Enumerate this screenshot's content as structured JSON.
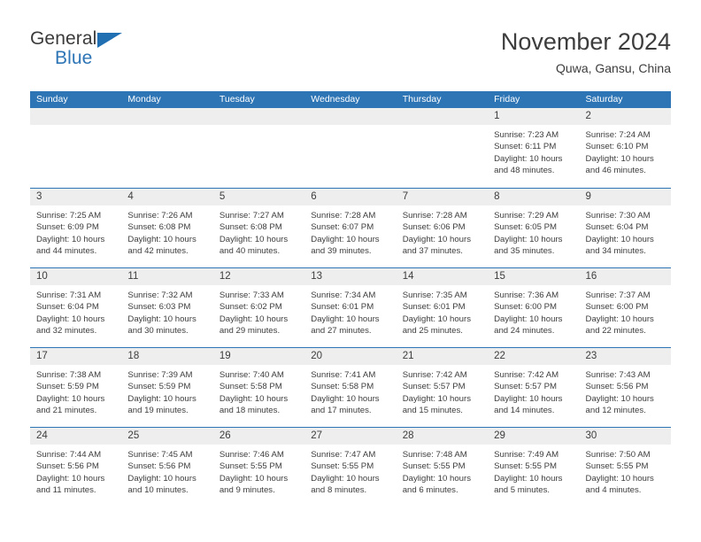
{
  "brand": {
    "word_general": "General",
    "word_blue": "Blue",
    "triangle_color": "#1f6fb2",
    "blue_color": "#2e75b6"
  },
  "header": {
    "title": "November 2024",
    "location": "Quwa, Gansu, China"
  },
  "calendar": {
    "header_color": "#2e75b6",
    "daynum_strip_color": "#eeeeee",
    "weekdays": [
      "Sunday",
      "Monday",
      "Tuesday",
      "Wednesday",
      "Thursday",
      "Friday",
      "Saturday"
    ],
    "weeks": [
      [
        {
          "day": "",
          "sunrise": "",
          "sunset": "",
          "daylight_line1": "",
          "daylight_line2": ""
        },
        {
          "day": "",
          "sunrise": "",
          "sunset": "",
          "daylight_line1": "",
          "daylight_line2": ""
        },
        {
          "day": "",
          "sunrise": "",
          "sunset": "",
          "daylight_line1": "",
          "daylight_line2": ""
        },
        {
          "day": "",
          "sunrise": "",
          "sunset": "",
          "daylight_line1": "",
          "daylight_line2": ""
        },
        {
          "day": "",
          "sunrise": "",
          "sunset": "",
          "daylight_line1": "",
          "daylight_line2": ""
        },
        {
          "day": "1",
          "sunrise": "Sunrise: 7:23 AM",
          "sunset": "Sunset: 6:11 PM",
          "daylight_line1": "Daylight: 10 hours",
          "daylight_line2": "and 48 minutes."
        },
        {
          "day": "2",
          "sunrise": "Sunrise: 7:24 AM",
          "sunset": "Sunset: 6:10 PM",
          "daylight_line1": "Daylight: 10 hours",
          "daylight_line2": "and 46 minutes."
        }
      ],
      [
        {
          "day": "3",
          "sunrise": "Sunrise: 7:25 AM",
          "sunset": "Sunset: 6:09 PM",
          "daylight_line1": "Daylight: 10 hours",
          "daylight_line2": "and 44 minutes."
        },
        {
          "day": "4",
          "sunrise": "Sunrise: 7:26 AM",
          "sunset": "Sunset: 6:08 PM",
          "daylight_line1": "Daylight: 10 hours",
          "daylight_line2": "and 42 minutes."
        },
        {
          "day": "5",
          "sunrise": "Sunrise: 7:27 AM",
          "sunset": "Sunset: 6:08 PM",
          "daylight_line1": "Daylight: 10 hours",
          "daylight_line2": "and 40 minutes."
        },
        {
          "day": "6",
          "sunrise": "Sunrise: 7:28 AM",
          "sunset": "Sunset: 6:07 PM",
          "daylight_line1": "Daylight: 10 hours",
          "daylight_line2": "and 39 minutes."
        },
        {
          "day": "7",
          "sunrise": "Sunrise: 7:28 AM",
          "sunset": "Sunset: 6:06 PM",
          "daylight_line1": "Daylight: 10 hours",
          "daylight_line2": "and 37 minutes."
        },
        {
          "day": "8",
          "sunrise": "Sunrise: 7:29 AM",
          "sunset": "Sunset: 6:05 PM",
          "daylight_line1": "Daylight: 10 hours",
          "daylight_line2": "and 35 minutes."
        },
        {
          "day": "9",
          "sunrise": "Sunrise: 7:30 AM",
          "sunset": "Sunset: 6:04 PM",
          "daylight_line1": "Daylight: 10 hours",
          "daylight_line2": "and 34 minutes."
        }
      ],
      [
        {
          "day": "10",
          "sunrise": "Sunrise: 7:31 AM",
          "sunset": "Sunset: 6:04 PM",
          "daylight_line1": "Daylight: 10 hours",
          "daylight_line2": "and 32 minutes."
        },
        {
          "day": "11",
          "sunrise": "Sunrise: 7:32 AM",
          "sunset": "Sunset: 6:03 PM",
          "daylight_line1": "Daylight: 10 hours",
          "daylight_line2": "and 30 minutes."
        },
        {
          "day": "12",
          "sunrise": "Sunrise: 7:33 AM",
          "sunset": "Sunset: 6:02 PM",
          "daylight_line1": "Daylight: 10 hours",
          "daylight_line2": "and 29 minutes."
        },
        {
          "day": "13",
          "sunrise": "Sunrise: 7:34 AM",
          "sunset": "Sunset: 6:01 PM",
          "daylight_line1": "Daylight: 10 hours",
          "daylight_line2": "and 27 minutes."
        },
        {
          "day": "14",
          "sunrise": "Sunrise: 7:35 AM",
          "sunset": "Sunset: 6:01 PM",
          "daylight_line1": "Daylight: 10 hours",
          "daylight_line2": "and 25 minutes."
        },
        {
          "day": "15",
          "sunrise": "Sunrise: 7:36 AM",
          "sunset": "Sunset: 6:00 PM",
          "daylight_line1": "Daylight: 10 hours",
          "daylight_line2": "and 24 minutes."
        },
        {
          "day": "16",
          "sunrise": "Sunrise: 7:37 AM",
          "sunset": "Sunset: 6:00 PM",
          "daylight_line1": "Daylight: 10 hours",
          "daylight_line2": "and 22 minutes."
        }
      ],
      [
        {
          "day": "17",
          "sunrise": "Sunrise: 7:38 AM",
          "sunset": "Sunset: 5:59 PM",
          "daylight_line1": "Daylight: 10 hours",
          "daylight_line2": "and 21 minutes."
        },
        {
          "day": "18",
          "sunrise": "Sunrise: 7:39 AM",
          "sunset": "Sunset: 5:59 PM",
          "daylight_line1": "Daylight: 10 hours",
          "daylight_line2": "and 19 minutes."
        },
        {
          "day": "19",
          "sunrise": "Sunrise: 7:40 AM",
          "sunset": "Sunset: 5:58 PM",
          "daylight_line1": "Daylight: 10 hours",
          "daylight_line2": "and 18 minutes."
        },
        {
          "day": "20",
          "sunrise": "Sunrise: 7:41 AM",
          "sunset": "Sunset: 5:58 PM",
          "daylight_line1": "Daylight: 10 hours",
          "daylight_line2": "and 17 minutes."
        },
        {
          "day": "21",
          "sunrise": "Sunrise: 7:42 AM",
          "sunset": "Sunset: 5:57 PM",
          "daylight_line1": "Daylight: 10 hours",
          "daylight_line2": "and 15 minutes."
        },
        {
          "day": "22",
          "sunrise": "Sunrise: 7:42 AM",
          "sunset": "Sunset: 5:57 PM",
          "daylight_line1": "Daylight: 10 hours",
          "daylight_line2": "and 14 minutes."
        },
        {
          "day": "23",
          "sunrise": "Sunrise: 7:43 AM",
          "sunset": "Sunset: 5:56 PM",
          "daylight_line1": "Daylight: 10 hours",
          "daylight_line2": "and 12 minutes."
        }
      ],
      [
        {
          "day": "24",
          "sunrise": "Sunrise: 7:44 AM",
          "sunset": "Sunset: 5:56 PM",
          "daylight_line1": "Daylight: 10 hours",
          "daylight_line2": "and 11 minutes."
        },
        {
          "day": "25",
          "sunrise": "Sunrise: 7:45 AM",
          "sunset": "Sunset: 5:56 PM",
          "daylight_line1": "Daylight: 10 hours",
          "daylight_line2": "and 10 minutes."
        },
        {
          "day": "26",
          "sunrise": "Sunrise: 7:46 AM",
          "sunset": "Sunset: 5:55 PM",
          "daylight_line1": "Daylight: 10 hours",
          "daylight_line2": "and 9 minutes."
        },
        {
          "day": "27",
          "sunrise": "Sunrise: 7:47 AM",
          "sunset": "Sunset: 5:55 PM",
          "daylight_line1": "Daylight: 10 hours",
          "daylight_line2": "and 8 minutes."
        },
        {
          "day": "28",
          "sunrise": "Sunrise: 7:48 AM",
          "sunset": "Sunset: 5:55 PM",
          "daylight_line1": "Daylight: 10 hours",
          "daylight_line2": "and 6 minutes."
        },
        {
          "day": "29",
          "sunrise": "Sunrise: 7:49 AM",
          "sunset": "Sunset: 5:55 PM",
          "daylight_line1": "Daylight: 10 hours",
          "daylight_line2": "and 5 minutes."
        },
        {
          "day": "30",
          "sunrise": "Sunrise: 7:50 AM",
          "sunset": "Sunset: 5:55 PM",
          "daylight_line1": "Daylight: 10 hours",
          "daylight_line2": "and 4 minutes."
        }
      ]
    ]
  }
}
